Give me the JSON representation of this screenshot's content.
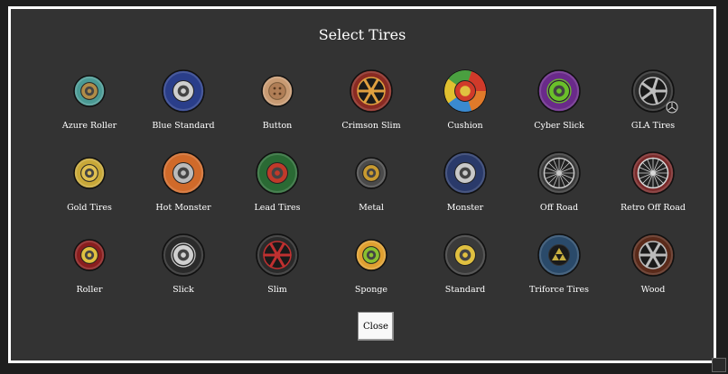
{
  "dialog": {
    "title": "Select Tires",
    "close_label": "Close"
  },
  "tires": [
    {
      "name": "Azure Roller",
      "icon": "azure-roller-tire-icon",
      "tread": "#4a9a94",
      "hub": "#b08c48",
      "style": "roller"
    },
    {
      "name": "Blue Standard",
      "icon": "blue-standard-tire-icon",
      "tread": "#2a3e8a",
      "hub": "#cfcfcf",
      "style": "standard"
    },
    {
      "name": "Button",
      "icon": "button-tire-icon",
      "tread": "#c89a72",
      "hub": "#b07e56",
      "style": "button"
    },
    {
      "name": "Crimson Slim",
      "icon": "crimson-slim-tire-icon",
      "tread": "#8a2a22",
      "hub": "#e0a040",
      "style": "spoke"
    },
    {
      "name": "Cushion",
      "icon": "cushion-tire-icon",
      "tread": "#e07a2a",
      "hub": "#d03a2a",
      "style": "cushion"
    },
    {
      "name": "Cyber Slick",
      "icon": "cyber-slick-tire-icon",
      "tread": "#6a2a8a",
      "hub": "#6ac02a",
      "style": "slick"
    },
    {
      "name": "GLA Tires",
      "icon": "gla-tire-icon",
      "tread": "#2c2c2c",
      "hub": "#bdbdbd",
      "style": "gla"
    },
    {
      "name": "Gold Tires",
      "icon": "gold-tire-icon",
      "tread": "#c8a838",
      "hub": "#e0c050",
      "style": "roller"
    },
    {
      "name": "Hot Monster",
      "icon": "hot-monster-tire-icon",
      "tread": "#d06a2a",
      "hub": "#bbbbbb",
      "style": "standard"
    },
    {
      "name": "Lead Tires",
      "icon": "lead-tire-icon",
      "tread": "#2a6a34",
      "hub": "#c03a2a",
      "style": "standard"
    },
    {
      "name": "Metal",
      "icon": "metal-tire-icon",
      "tread": "#4a4a4a",
      "hub": "#c89a30",
      "style": "roller"
    },
    {
      "name": "Monster",
      "icon": "monster-tire-icon",
      "tread": "#2a3a6a",
      "hub": "#c8c8c8",
      "style": "standard"
    },
    {
      "name": "Off Road",
      "icon": "off-road-tire-icon",
      "tread": "#3a3a3a",
      "hub": "#c8c8c8",
      "style": "wire"
    },
    {
      "name": "Retro Off Road",
      "icon": "retro-off-road-tire-icon",
      "tread": "#7a2a2a",
      "hub": "#d8d8d8",
      "style": "wire"
    },
    {
      "name": "Roller",
      "icon": "roller-tire-icon",
      "tread": "#8a1e1e",
      "hub": "#e0c040",
      "style": "roller"
    },
    {
      "name": "Slick",
      "icon": "slick-tire-icon",
      "tread": "#2a2a2a",
      "hub": "#d0d0d0",
      "style": "slick"
    },
    {
      "name": "Slim",
      "icon": "slim-tire-icon",
      "tread": "#2a2a2a",
      "hub": "#c03030",
      "style": "spoke"
    },
    {
      "name": "Sponge",
      "icon": "sponge-tire-icon",
      "tread": "#e0a030",
      "hub": "#8ac030",
      "style": "roller"
    },
    {
      "name": "Standard",
      "icon": "standard-tire-icon",
      "tread": "#3a3a3a",
      "hub": "#e0c040",
      "style": "standard"
    },
    {
      "name": "Triforce Tires",
      "icon": "triforce-tire-icon",
      "tread": "#2a4a6a",
      "hub": "#c8b040",
      "style": "triforce"
    },
    {
      "name": "Wood",
      "icon": "wood-tire-icon",
      "tread": "#5a2a1a",
      "hub": "#bbbbbb",
      "style": "spoke"
    }
  ]
}
